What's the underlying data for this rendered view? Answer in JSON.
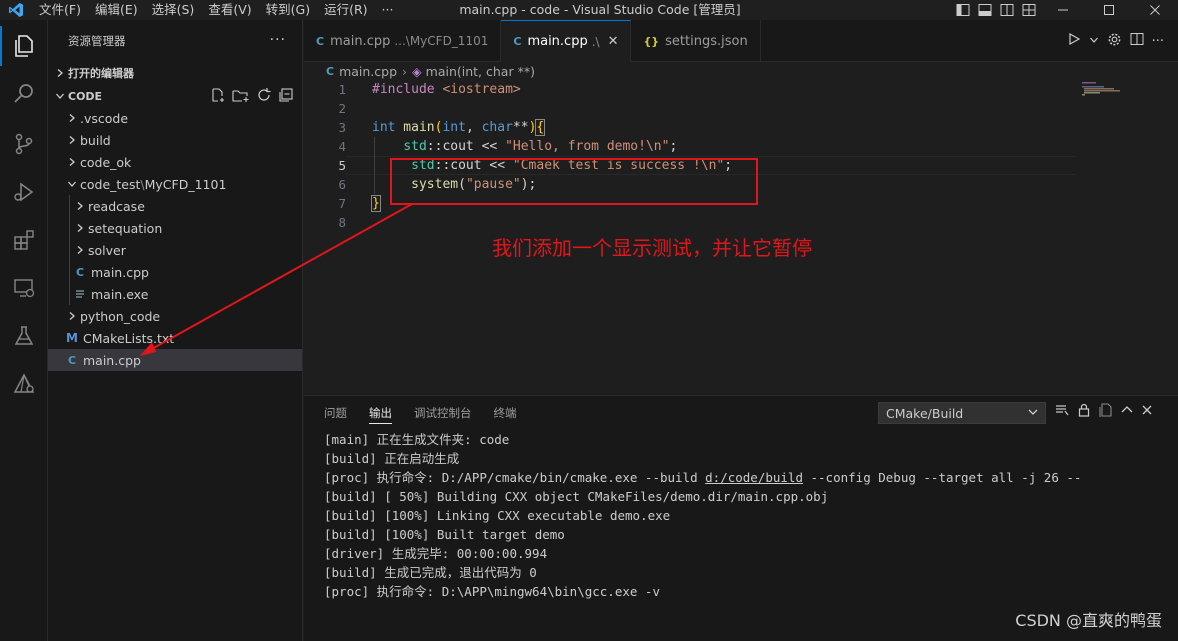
{
  "titlebar": {
    "menus": [
      "文件(F)",
      "编辑(E)",
      "选择(S)",
      "查看(V)",
      "转到(G)",
      "运行(R)",
      "···"
    ],
    "title": "main.cpp - code - Visual Studio Code [管理员]"
  },
  "sidebar": {
    "header": "资源管理器",
    "more": "···",
    "open_editors": "打开的编辑器",
    "root": "CODE",
    "tree": [
      {
        "label": ".vscode",
        "type": "folder",
        "depth": 1
      },
      {
        "label": "build",
        "type": "folder",
        "depth": 1
      },
      {
        "label": "code_ok",
        "type": "folder",
        "depth": 1
      },
      {
        "label": "code_test",
        "suffix": "MyCFD_1101",
        "type": "folder-open",
        "depth": 1
      },
      {
        "label": "readcase",
        "type": "folder",
        "depth": 2
      },
      {
        "label": "setequation",
        "type": "folder",
        "depth": 2
      },
      {
        "label": "solver",
        "type": "folder",
        "depth": 2
      },
      {
        "label": "main.cpp",
        "type": "cpp",
        "depth": 2
      },
      {
        "label": "main.exe",
        "type": "exe",
        "depth": 2
      },
      {
        "label": "python_code",
        "type": "folder",
        "depth": 1
      },
      {
        "label": "CMakeLists.txt",
        "type": "cmake",
        "depth": 1
      },
      {
        "label": "main.cpp",
        "type": "cpp",
        "depth": 1,
        "selected": true
      }
    ]
  },
  "tabs": [
    {
      "label": "main.cpp",
      "desc": "...\\MyCFD_1101",
      "active": false
    },
    {
      "label": "main.cpp",
      "desc": ".\\",
      "active": true,
      "close": "✕"
    },
    {
      "label": "settings.json",
      "desc": "",
      "active": false
    }
  ],
  "breadcrumb": {
    "file": "main.cpp",
    "symbol": "main(int, char **)"
  },
  "editor": {
    "line_numbers": [
      "1",
      "2",
      "3",
      "4",
      "5",
      "6",
      "7",
      "8"
    ],
    "code": {
      "l1_kw": "#include",
      "l1_inc": " <iostream>",
      "l3_int": "int",
      "l3_main": " main",
      "l3_paren_open": "(",
      "l3_int2": "int",
      "l3_comma": ", ",
      "l3_char": "char",
      "l3_stars": "**",
      "l3_paren_close": ")",
      "l3_brace": "{",
      "l4_std": "std",
      "l4_cout": "::cout << ",
      "l4_str": "\"Hello, from demo!\\n\"",
      "l4_end": ";",
      "l5_std": "std",
      "l5_cout": "::cout << ",
      "l5_str": "\"Cmaek test is success !\\n\"",
      "l5_end": ";",
      "l6_fn": "system",
      "l6_open": "(",
      "l6_str": "\"pause\"",
      "l6_end": ");",
      "l7_brace": "}"
    }
  },
  "annotation": {
    "text": "我们添加一个显示测试，并让它暂停"
  },
  "panel": {
    "tabs": [
      "问题",
      "输出",
      "调试控制台",
      "终端"
    ],
    "active_tab": "输出",
    "select_value": "CMake/Build",
    "output_lines": [
      {
        "a": "[main] 正在生成文件夹: code"
      },
      {
        "a": "[build] 正在启动生成"
      },
      {
        "a": "[proc] 执行命令: D:/APP/cmake/bin/cmake.exe --build ",
        "link": "d:/code/build",
        "b": " --config Debug --target all -j 26 --"
      },
      {
        "a": "[build] [ 50%] Building CXX object CMakeFiles/demo.dir/main.cpp.obj"
      },
      {
        "a": "[build] [100%] Linking CXX executable demo.exe"
      },
      {
        "a": "[build] [100%] Built target demo"
      },
      {
        "a": "[driver] 生成完毕: 00:00:00.994"
      },
      {
        "a": "[build] 生成已完成，退出代码为 0"
      },
      {
        "a": "[proc] 执行命令: D:\\APP\\mingw64\\bin\\gcc.exe -v"
      }
    ]
  },
  "watermark": "CSDN @直爽的鸭蛋",
  "colors": {
    "accent": "#0078d4",
    "annotation": "#e0161c",
    "cpp_icon": "#519aba",
    "cmake_icon": "#5b8fd6"
  }
}
